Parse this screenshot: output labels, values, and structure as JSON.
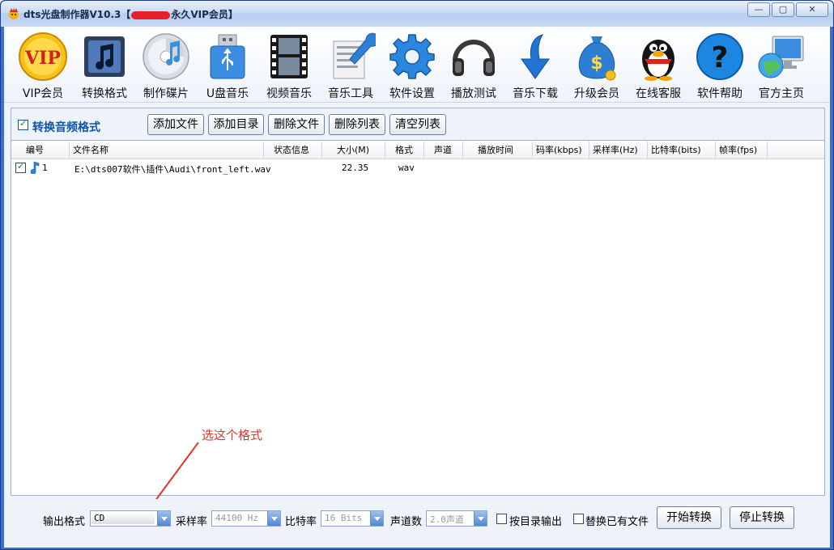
{
  "window": {
    "title_prefix": "dts光盘制作器V10.3【",
    "title_suffix": "永久VIP会员】",
    "minimize": "—",
    "maximize": "▢",
    "close": "✕"
  },
  "toolbar": {
    "items": [
      {
        "label": "VIP会员",
        "icon": "vip-badge-icon"
      },
      {
        "label": "转换格式",
        "icon": "music-note-icon"
      },
      {
        "label": "制作碟片",
        "icon": "cd-disc-icon"
      },
      {
        "label": "U盘音乐",
        "icon": "usb-drive-icon"
      },
      {
        "label": "视频音乐",
        "icon": "film-strip-icon"
      },
      {
        "label": "音乐工具",
        "icon": "tools-icon"
      },
      {
        "label": "软件设置",
        "icon": "gear-icon"
      },
      {
        "label": "播放测试",
        "icon": "headphones-icon"
      },
      {
        "label": "音乐下载",
        "icon": "download-arrow-icon"
      },
      {
        "label": "升级会员",
        "icon": "money-bag-icon"
      },
      {
        "label": "在线客服",
        "icon": "penguin-icon"
      },
      {
        "label": "软件帮助",
        "icon": "help-icon"
      },
      {
        "label": "官方主页",
        "icon": "globe-computer-icon"
      }
    ]
  },
  "convert_section": {
    "title": "转换音频格式",
    "checked": true,
    "buttons": {
      "add_file": "添加文件",
      "add_dir": "添加目录",
      "delete_file": "删除文件",
      "delete_list": "删除列表",
      "clear_list": "清空列表"
    }
  },
  "file_list": {
    "columns": [
      "编号",
      "文件名称",
      "状态信息",
      "大小(M)",
      "格式",
      "声道",
      "播放时间",
      "码率(kbps)",
      "采样率(Hz)",
      "比特率(bits)",
      "帧率(fps)"
    ],
    "rows": [
      {
        "index": "1",
        "name": "E:\\dts007软件\\插件\\Audi\\front_left.wav",
        "status": "",
        "size": "22.35",
        "format": "wav",
        "channels": "",
        "duration": "",
        "bitrate": "",
        "samplerate": "",
        "bits": "",
        "fps": ""
      }
    ]
  },
  "annotation": {
    "text": "选这个格式",
    "color": "#e0352b"
  },
  "output": {
    "format_label": "输出格式",
    "format_value": "CD",
    "samplerate_label": "采样率",
    "samplerate_value": "44100 Hz",
    "bits_label": "比特率",
    "bits_value": "16 Bits",
    "channels_label": "声道数",
    "channels_value": "2.0声道",
    "by_dir_label": "按目录输出",
    "replace_label": "替换已有文件",
    "start_label": "开始转换",
    "stop_label": "停止转换"
  },
  "colors": {
    "accent": "#0b55b3",
    "frame": "#3a6fd1"
  }
}
